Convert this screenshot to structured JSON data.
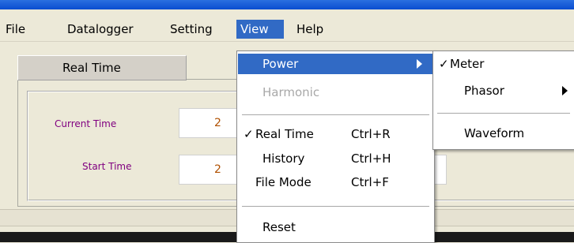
{
  "menubar": {
    "file": "File",
    "datalogger": "Datalogger",
    "setting": "Setting",
    "view": "View",
    "help": "Help"
  },
  "tab": {
    "label": "Real Time"
  },
  "panel": {
    "current_time_label": "Current Time",
    "start_time_label": "Start Time",
    "current_time_value": "2",
    "start_time_value": "2"
  },
  "view_menu": {
    "power": "Power",
    "harmonic": "Harmonic",
    "real_time": "Real Time",
    "real_time_shortcut": "Ctrl+R",
    "history": "History",
    "history_shortcut": "Ctrl+H",
    "file_mode": "File Mode",
    "file_mode_shortcut": "Ctrl+F",
    "reset": "Reset",
    "check_mark": "✓"
  },
  "power_submenu": {
    "meter": "Meter",
    "phasor": "Phasor",
    "waveform": "Waveform",
    "check_mark": "✓"
  },
  "colors": {
    "highlight": "#316ac5",
    "label_purple": "#800080",
    "value_orange": "#b05000"
  }
}
